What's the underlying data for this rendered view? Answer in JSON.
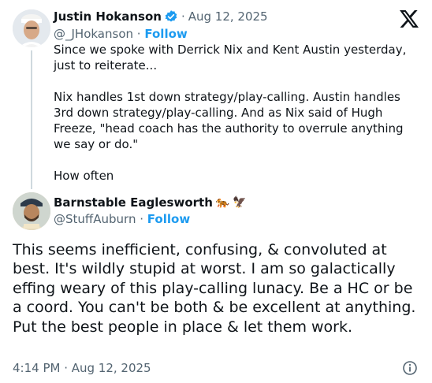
{
  "parent_tweet": {
    "display_name": "Justin Hokanson",
    "separator": "·",
    "date": "Aug 12, 2025",
    "handle": "@_JHokanson",
    "follow_separator": "·",
    "follow_label": "Follow",
    "text": "Since we spoke with Derrick Nix and Kent Austin yesterday,\njust to reiterate...\n\nNix handles 1st down strategy/play-calling. Austin handles\n3rd down strategy/play-calling. And as Nix said of Hugh\nFreeze, \"head coach has the authority to overrule anything\nwe say or do.\"\n\nHow often"
  },
  "reply_tweet": {
    "display_name": "Barnstable Eaglesworth",
    "emoji_1": "🐅",
    "emoji_2": "🦅",
    "handle": "@StuffAuburn",
    "follow_separator": "·",
    "follow_label": "Follow",
    "text": "This seems inefficient, confusing, & convoluted at best. It's wildly stupid at worst. I am so galactically effing weary of this play-calling lunacy. Be a HC or be a coord. You can't be both & be excellent at anything. Put the best people in place & let them work.",
    "timestamp": "4:14 PM · Aug 12, 2025"
  },
  "icons": {
    "verified": "verified-badge-icon",
    "platform": "x-logo-icon",
    "info": "info-icon"
  },
  "colors": {
    "accent": "#1d9bf0",
    "secondary_text": "#536471",
    "thread_line": "#cfd9de"
  }
}
